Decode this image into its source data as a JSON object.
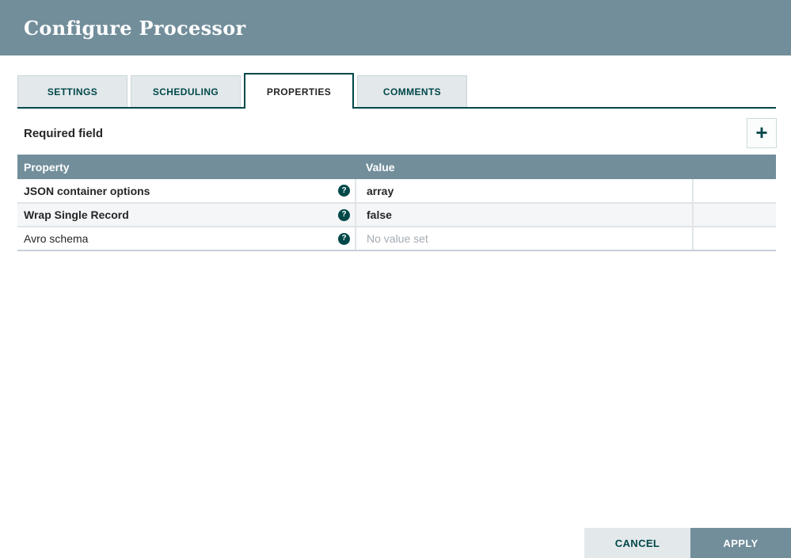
{
  "dialog": {
    "title": "Configure Processor"
  },
  "tabs": [
    {
      "label": "SETTINGS",
      "active": false
    },
    {
      "label": "SCHEDULING",
      "active": false
    },
    {
      "label": "PROPERTIES",
      "active": true
    },
    {
      "label": "COMMENTS",
      "active": false
    }
  ],
  "toolbar": {
    "required_field_label": "Required field",
    "add_button_glyph": "+"
  },
  "table": {
    "columns": [
      "Property",
      "Value"
    ],
    "help_glyph": "?",
    "rows": [
      {
        "property": "JSON container options",
        "value": "array",
        "required": true
      },
      {
        "property": "Wrap Single Record",
        "value": "false",
        "required": true
      },
      {
        "property": "Avro schema",
        "value": "No value set",
        "required": false,
        "value_unset": true
      }
    ]
  },
  "footer": {
    "cancel_label": "CANCEL",
    "apply_label": "APPLY"
  },
  "colors": {
    "header_bg": "#728E9B",
    "accent_teal": "#004849",
    "inactive_tab_bg": "#E3E8EB",
    "alt_row_bg": "#F4F6F7",
    "unset_text": "#A6ACB2"
  }
}
